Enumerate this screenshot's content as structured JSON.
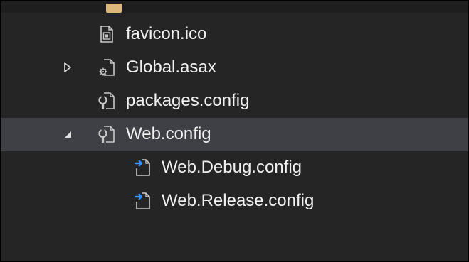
{
  "explorer": {
    "items": [
      {
        "label": "favicon.ico",
        "icon": "ico-file-icon",
        "expander": "none",
        "selected": false
      },
      {
        "label": "Global.asax",
        "icon": "asax-file-icon",
        "expander": "collapsed",
        "selected": false
      },
      {
        "label": "packages.config",
        "icon": "config-file-icon",
        "expander": "none",
        "selected": false
      },
      {
        "label": "Web.config",
        "icon": "config-file-icon",
        "expander": "expanded",
        "selected": true
      },
      {
        "label": "Web.Debug.config",
        "icon": "transform-config-icon",
        "expander": "none",
        "selected": false
      },
      {
        "label": "Web.Release.config",
        "icon": "transform-config-icon",
        "expander": "none",
        "selected": false
      }
    ]
  },
  "colors": {
    "background": "#252526",
    "selection": "#3f3f46",
    "text": "#f1f1f1",
    "transform_arrow": "#3794ff",
    "folder": "#dcb67a"
  }
}
